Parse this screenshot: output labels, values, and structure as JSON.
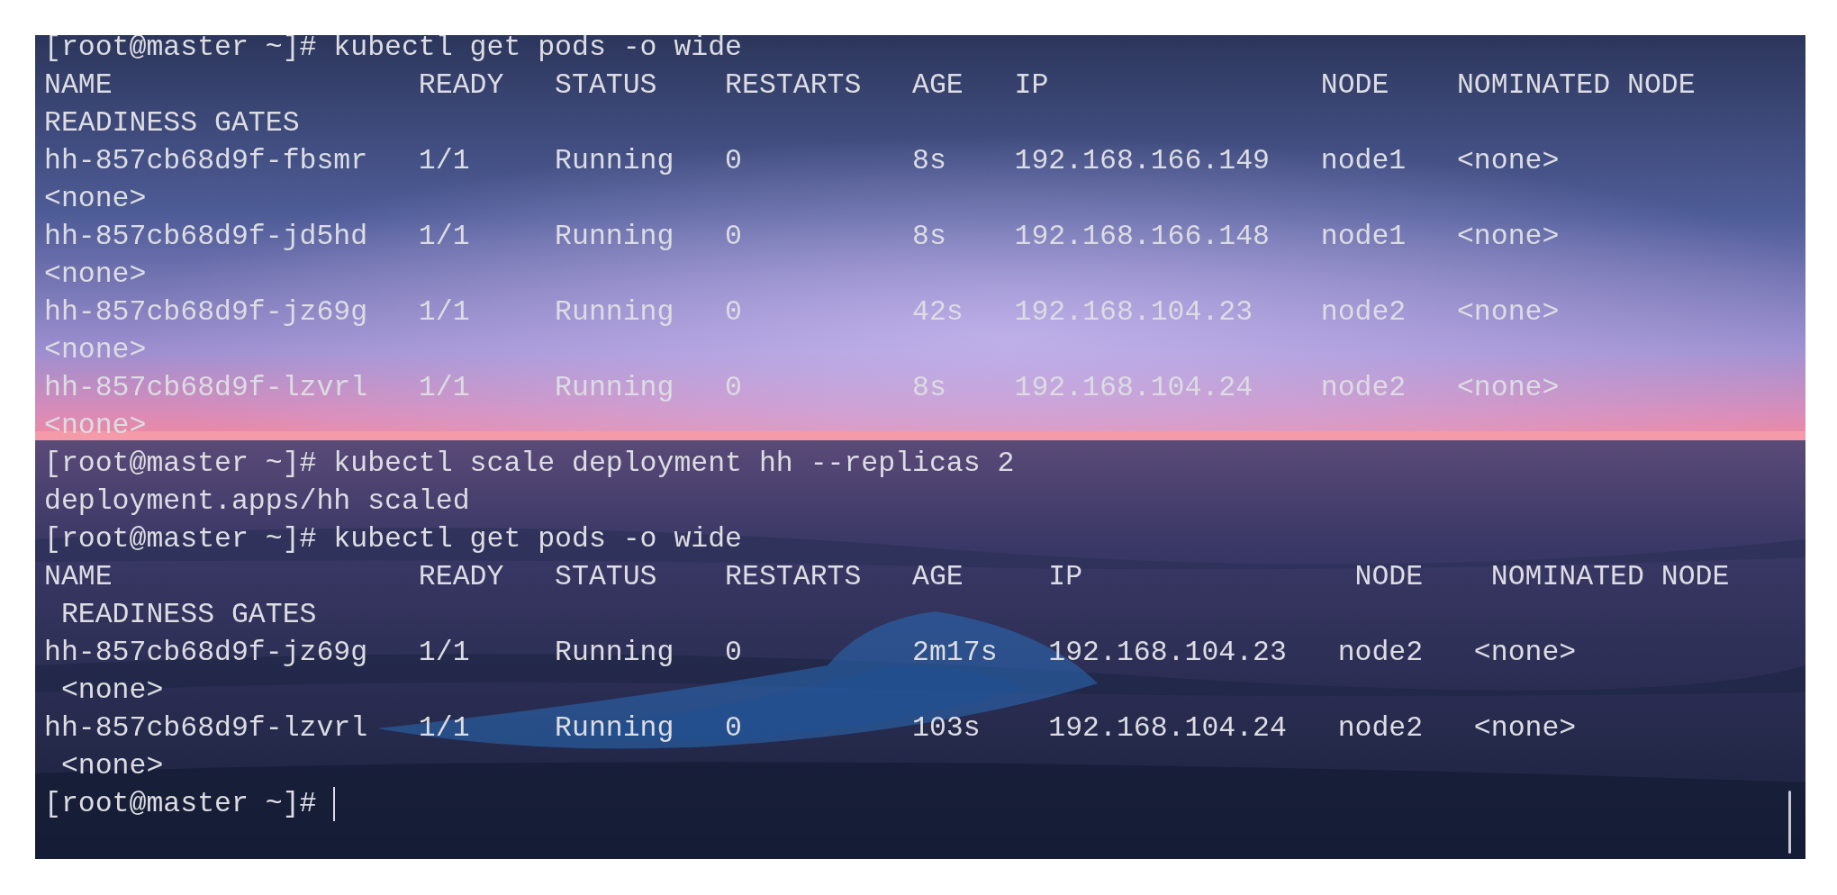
{
  "terminal": {
    "lines": [
      "[root@master ~]# kubectl get pods -o wide",
      "NAME                  READY   STATUS    RESTARTS   AGE   IP                NODE    NOMINATED NODE",
      "READINESS GATES",
      "hh-857cb68d9f-fbsmr   1/1     Running   0          8s    192.168.166.149   node1   <none>",
      "<none>",
      "hh-857cb68d9f-jd5hd   1/1     Running   0          8s    192.168.166.148   node1   <none>",
      "<none>",
      "hh-857cb68d9f-jz69g   1/1     Running   0          42s   192.168.104.23    node2   <none>",
      "<none>",
      "hh-857cb68d9f-lzvrl   1/1     Running   0          8s    192.168.104.24    node2   <none>",
      "<none>",
      "[root@master ~]# kubectl scale deployment hh --replicas 2",
      "deployment.apps/hh scaled",
      "[root@master ~]# kubectl get pods -o wide",
      "NAME                  READY   STATUS    RESTARTS   AGE     IP                NODE    NOMINATED NODE",
      " READINESS GATES",
      "hh-857cb68d9f-jz69g   1/1     Running   0          2m17s   192.168.104.23   node2   <none>",
      " <none>",
      "hh-857cb68d9f-lzvrl   1/1     Running   0          103s    192.168.104.24   node2   <none>",
      " <none>",
      "[root@master ~]# "
    ]
  }
}
